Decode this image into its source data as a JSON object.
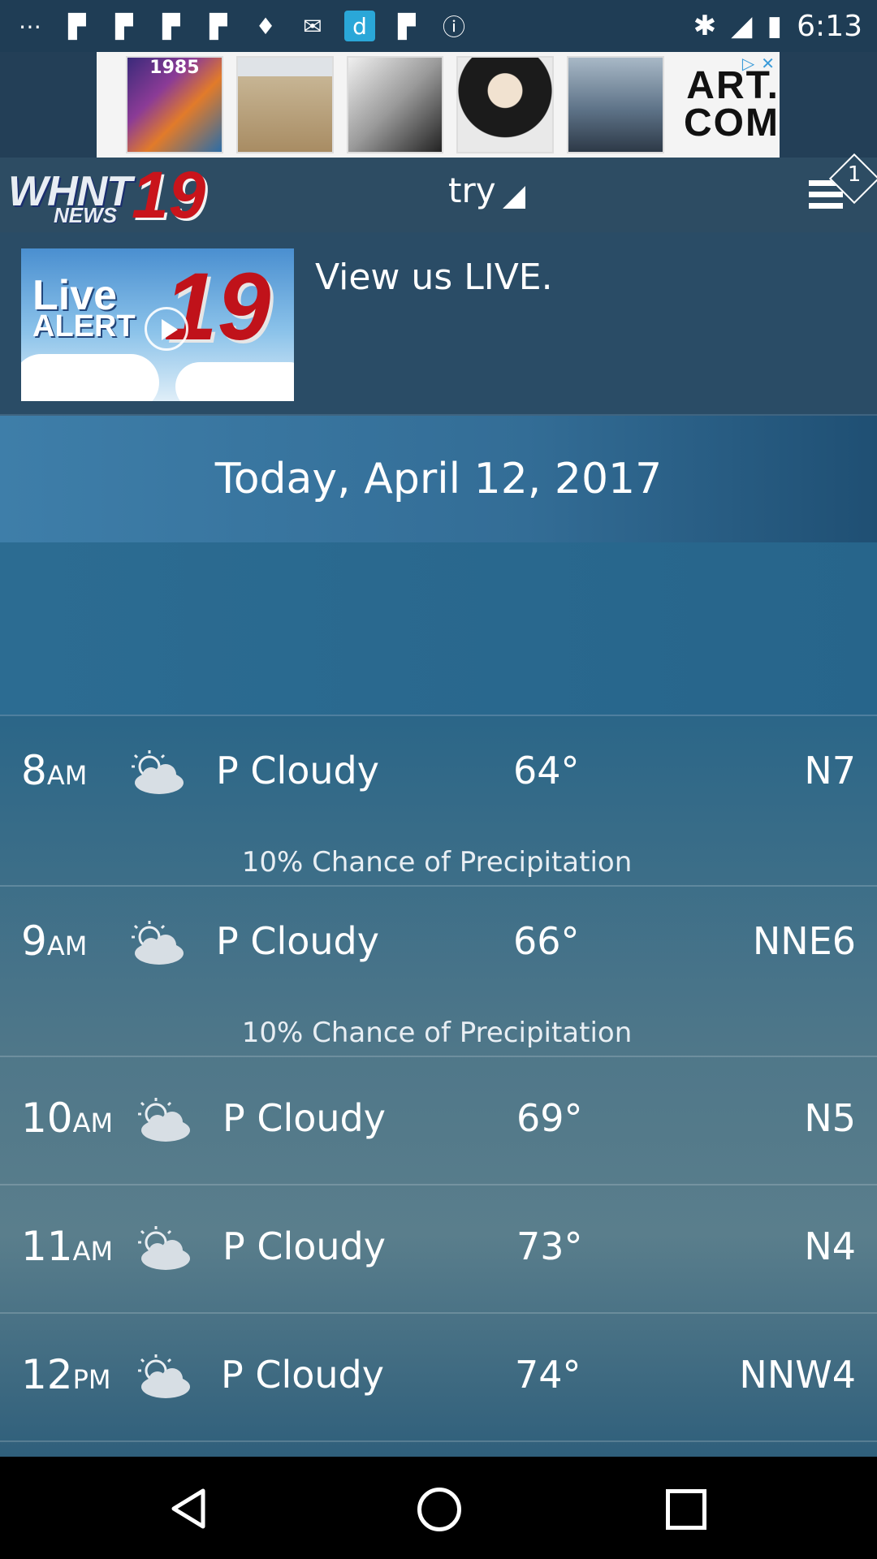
{
  "status_bar": {
    "time": "6:13",
    "icons": [
      "more-icon",
      "flipboard-icon",
      "flipboard-icon",
      "flipboard-icon",
      "flipboard-icon",
      "keyhole-icon",
      "mail-icon",
      "dictionary-icon",
      "flipboard-icon",
      "info-icon",
      "bluetooth-icon",
      "signal-icon",
      "battery-icon"
    ]
  },
  "ad": {
    "brand_line1": "ART.",
    "brand_line2": "COM",
    "thumb1_text": "1985"
  },
  "header": {
    "logo_text": "WHNT",
    "logo_number": "19",
    "logo_subtext": "NEWS",
    "location": "try",
    "notification_count": "1"
  },
  "live": {
    "thumb_text_top": "Live",
    "thumb_text_bottom": "ALERT",
    "thumb_number": "19",
    "label": "View us LIVE."
  },
  "date": "Today, April 12, 2017",
  "hourly": [
    {
      "hour": "8",
      "ampm": "AM",
      "condition": "P Cloudy",
      "temp": "64°",
      "wind": "N7",
      "precip": "10% Chance of Precipitation"
    },
    {
      "hour": "9",
      "ampm": "AM",
      "condition": "P Cloudy",
      "temp": "66°",
      "wind": "NNE6",
      "precip": "10% Chance of Precipitation"
    },
    {
      "hour": "10",
      "ampm": "AM",
      "condition": "P Cloudy",
      "temp": "69°",
      "wind": "N5",
      "precip": ""
    },
    {
      "hour": "11",
      "ampm": "AM",
      "condition": "P Cloudy",
      "temp": "73°",
      "wind": "N4",
      "precip": ""
    },
    {
      "hour": "12",
      "ampm": "PM",
      "condition": "P Cloudy",
      "temp": "74°",
      "wind": "NNW4",
      "precip": ""
    }
  ],
  "colors": {
    "header_bg": "#2d4c63",
    "logo_red": "#c9141b"
  }
}
